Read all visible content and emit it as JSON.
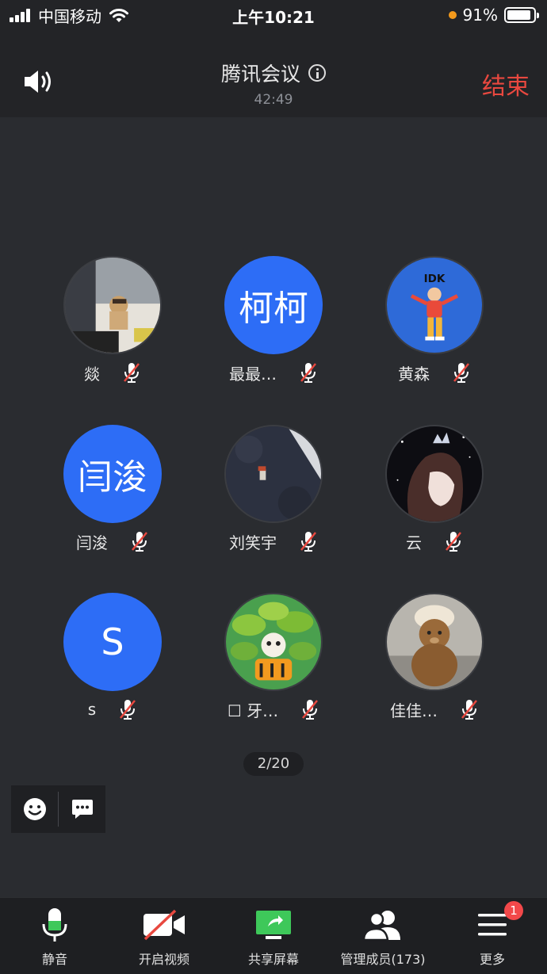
{
  "status_bar": {
    "carrier": "中国移动",
    "time": "上午10:21",
    "battery": "91%",
    "battery_level": 0.91
  },
  "header": {
    "title": "腾讯会议",
    "duration": "42:49",
    "end_label": "结束"
  },
  "participants": [
    {
      "name": "燚",
      "avatar_type": "photo",
      "avatar_desc": "cat-photo",
      "muted": true
    },
    {
      "name": "最最…",
      "avatar_type": "text",
      "avatar_text": "柯柯",
      "muted": true
    },
    {
      "name": "黄森",
      "avatar_type": "photo",
      "avatar_desc": "idk-cartoon",
      "muted": true
    },
    {
      "name": "闫浚",
      "avatar_type": "text",
      "avatar_text": "闫浚",
      "muted": true
    },
    {
      "name": "刘笑宇",
      "avatar_type": "photo",
      "avatar_desc": "astronaut-photo",
      "muted": true
    },
    {
      "name": "云",
      "avatar_type": "photo",
      "avatar_desc": "anime-girl",
      "muted": true
    },
    {
      "name": "s",
      "avatar_type": "text",
      "avatar_text": "S",
      "muted": true
    },
    {
      "name": "☐ 牙…",
      "avatar_type": "photo",
      "avatar_desc": "tiger-in-leaves",
      "muted": true
    },
    {
      "name": "佳佳…",
      "avatar_type": "photo",
      "avatar_desc": "teddy-bear",
      "muted": true
    }
  ],
  "page_indicator": "2/20",
  "toolbar": {
    "mute_label": "静音",
    "video_label": "开启视频",
    "share_label": "共享屏幕",
    "members_label": "管理成员(173)",
    "more_label": "更多",
    "more_badge": "1"
  },
  "colors": {
    "accent_blue": "#2d6df6",
    "end_red": "#e8483f",
    "mic_green": "#3ec85a",
    "badge_red": "#f2484a"
  }
}
